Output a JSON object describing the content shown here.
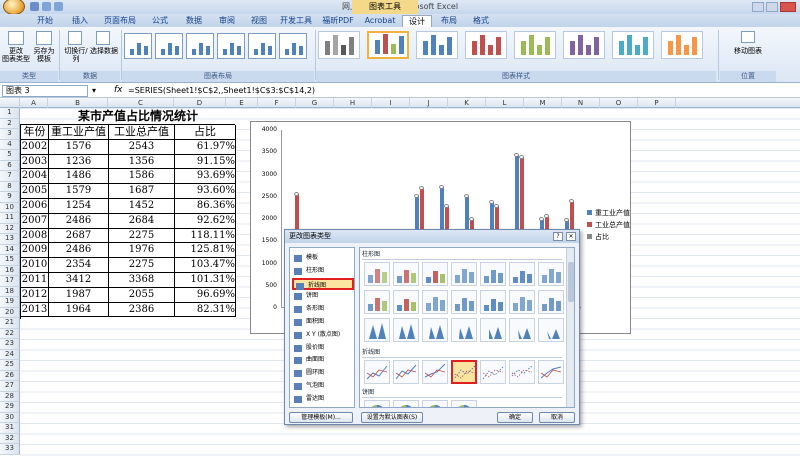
{
  "window": {
    "title": "网上企业个数 - Microsoft Excel",
    "context_tab": "图表工具"
  },
  "tabs": [
    "开始",
    "插入",
    "页面布局",
    "公式",
    "数据",
    "审阅",
    "视图",
    "开发工具",
    "福昕PDF",
    "Acrobat",
    "设计",
    "布局",
    "格式"
  ],
  "active_tab": "设计",
  "ribbon": {
    "groups": [
      {
        "label": "类型",
        "buttons": [
          "更改\n图表类型",
          "另存为\n模板"
        ]
      },
      {
        "label": "数据",
        "buttons": [
          "切换行/列",
          "选择数据"
        ]
      },
      {
        "label": "图表布局",
        "buttons": []
      },
      {
        "label": "图表样式",
        "buttons": []
      },
      {
        "label": "位置",
        "buttons": [
          "移动图表"
        ]
      }
    ]
  },
  "formula_bar": {
    "name_box": "图表 3",
    "formula": "=SERIES(Sheet1!$C$2,,Sheet1!$C$3:$C$14,2)"
  },
  "sheet": {
    "columns": [
      "A",
      "B",
      "C",
      "D",
      "E",
      "F",
      "G",
      "H",
      "I",
      "J",
      "K",
      "L",
      "M",
      "N",
      "O",
      "P"
    ],
    "title": "某市产值占比情况统计",
    "headers": [
      "年份",
      "重工业产值",
      "工业总产值",
      "占比"
    ],
    "rows": [
      [
        "2002",
        "1576",
        "2543",
        "61.97%"
      ],
      [
        "2003",
        "1236",
        "1356",
        "91.15%"
      ],
      [
        "2004",
        "1486",
        "1586",
        "93.69%"
      ],
      [
        "2005",
        "1579",
        "1687",
        "93.60%"
      ],
      [
        "2006",
        "1254",
        "1452",
        "86.36%"
      ],
      [
        "2007",
        "2486",
        "2684",
        "92.62%"
      ],
      [
        "2008",
        "2687",
        "2275",
        "118.11%"
      ],
      [
        "2009",
        "2486",
        "1976",
        "125.81%"
      ],
      [
        "2010",
        "2354",
        "2275",
        "103.47%"
      ],
      [
        "2011",
        "3412",
        "3368",
        "101.31%"
      ],
      [
        "2012",
        "1987",
        "2055",
        "96.69%"
      ],
      [
        "2013",
        "1964",
        "2386",
        "82.31%"
      ]
    ]
  },
  "chart": {
    "y_ticks": [
      "4000",
      "3500",
      "3000",
      "2500",
      "2000",
      "1500",
      "1000",
      "500",
      "0"
    ],
    "ymax": 4000,
    "series": [
      {
        "name": "重工业产值",
        "color": "#4f81bd",
        "values": [
          1576,
          1236,
          1486,
          1579,
          1254,
          2486,
          2687,
          2486,
          2354,
          3412,
          1987,
          1964
        ]
      },
      {
        "name": "工业总产值",
        "color": "#c0504d",
        "values": [
          2543,
          1356,
          1586,
          1687,
          1452,
          2684,
          2275,
          1976,
          2275,
          3368,
          2055,
          2386
        ]
      }
    ],
    "legend": [
      "重工业产值",
      "工业总产值",
      "占比"
    ]
  },
  "dialog": {
    "title": "更改图表类型",
    "categories": [
      "模板",
      "柱形图",
      "折线图",
      "饼图",
      "条形图",
      "面积图",
      "X Y (散点图)",
      "股价图",
      "曲面图",
      "圆环图",
      "气泡图",
      "雷达图"
    ],
    "selected_category": "折线图",
    "sections": [
      "柱形图",
      "折线图",
      "饼图"
    ],
    "buttons": {
      "manage": "管理模板(M)...",
      "default": "设置为默认图表(S)",
      "ok": "确定",
      "cancel": "取消"
    }
  },
  "row_numbers": [
    "1",
    "2",
    "3",
    "4",
    "5",
    "6",
    "7",
    "8",
    "9",
    "10",
    "11",
    "12",
    "13",
    "14",
    "15",
    "16",
    "17",
    "18",
    "19",
    "20",
    "21",
    "22",
    "23",
    "24",
    "25",
    "26",
    "27",
    "28",
    "29",
    "30",
    "31",
    "32",
    "33"
  ]
}
